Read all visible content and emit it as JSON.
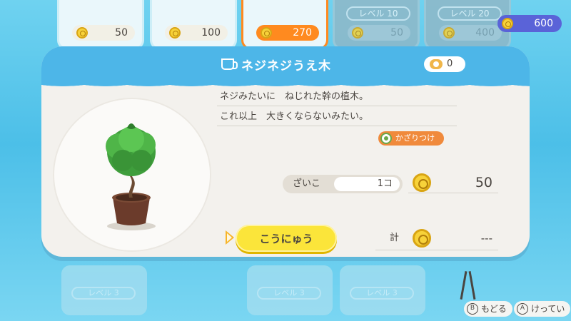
{
  "currency": {
    "amount": "600",
    "icon": "coin-icon"
  },
  "top_cards": [
    {
      "level": "",
      "price": "50",
      "state": "normal"
    },
    {
      "level": "",
      "price": "100",
      "state": "normal"
    },
    {
      "level": "",
      "price": "270",
      "state": "selected"
    },
    {
      "level": "レベル 10",
      "price": "50",
      "state": "locked"
    },
    {
      "level": "レベル 20",
      "price": "400",
      "state": "locked"
    }
  ],
  "bottom_cards": [
    {
      "level": "レベル 3"
    },
    {
      "level": "レベル 3"
    },
    {
      "level": "レベル 3"
    }
  ],
  "dialog": {
    "title": "ネジネジうえ木",
    "title_icon": "cup-icon",
    "owned_count": "0",
    "description_line1": "ネジみたいに　ねじれた幹の植木。",
    "description_line2": "これ以上　大きくならないみたい。",
    "tag_label": "かざりつけ",
    "stock_label": "ざいこ",
    "stock_value": "1コ",
    "price": "50",
    "buy_label": "こうにゅう",
    "total_label": "計",
    "total_value": "---",
    "item_icon": "potted-twisted-tree"
  },
  "hints": {
    "back_button": "B",
    "back_label": "もどる",
    "confirm_button": "A",
    "confirm_label": "けってい"
  },
  "colors": {
    "background": "#5cc7ea",
    "header": "#4db6e8",
    "buy_button": "#fbe53a",
    "tag": "#f08a3c",
    "currency_pill": "#5a63d8"
  }
}
